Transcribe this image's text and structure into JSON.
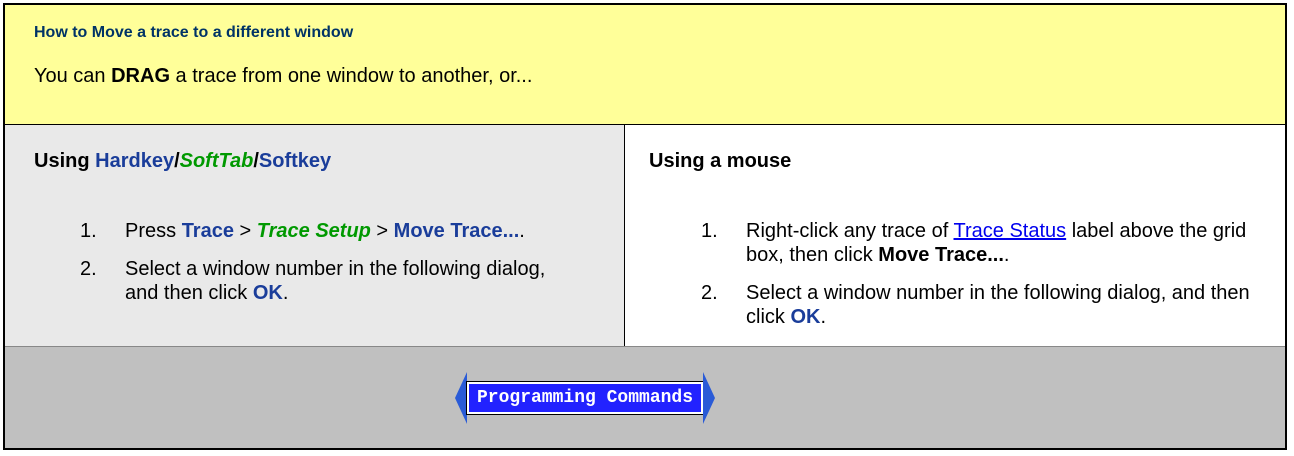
{
  "header": {
    "title": "How to Move a trace to a different window",
    "lead_prefix": "You can ",
    "lead_bold": "DRAG",
    "lead_suffix": " a trace from one window to another, or..."
  },
  "left": {
    "title_prefix": "Using ",
    "title_hardkey": "Hardkey",
    "title_sep1": "/",
    "title_softtab": "SoftTab",
    "title_sep2": "/",
    "title_softkey": "Softkey",
    "steps": [
      {
        "num": "1.",
        "p1": "Press ",
        "k1": "Trace",
        "s1": " > ",
        "k2": "Trace Setup",
        "s2": " > ",
        "k3": "Move Trace...",
        "end": "."
      },
      {
        "num": "2.",
        "text": "Select a window number in the following dialog, and then click ",
        "ok": "OK",
        "end": "."
      }
    ]
  },
  "right": {
    "title": "Using a mouse",
    "steps": [
      {
        "num": "1.",
        "p1": "Right-click any trace of ",
        "link": "Trace Status",
        "p2": " label above the grid box, then click ",
        "bold": "Move Trace...",
        "end": "."
      },
      {
        "num": "2.",
        "text": "Select a window number in the following dialog, and then click ",
        "ok": "OK",
        "end": "."
      }
    ]
  },
  "footer": {
    "button_label": "Programming Commands"
  },
  "colors": {
    "header_bg": "#ffff99",
    "left_bg": "#e9e9e9",
    "footer_bg": "#c0c0c0",
    "key_blue": "#1a3d9a",
    "softtab_green": "#009900",
    "link_blue": "#0000ee",
    "button_blue": "#2222ff"
  }
}
